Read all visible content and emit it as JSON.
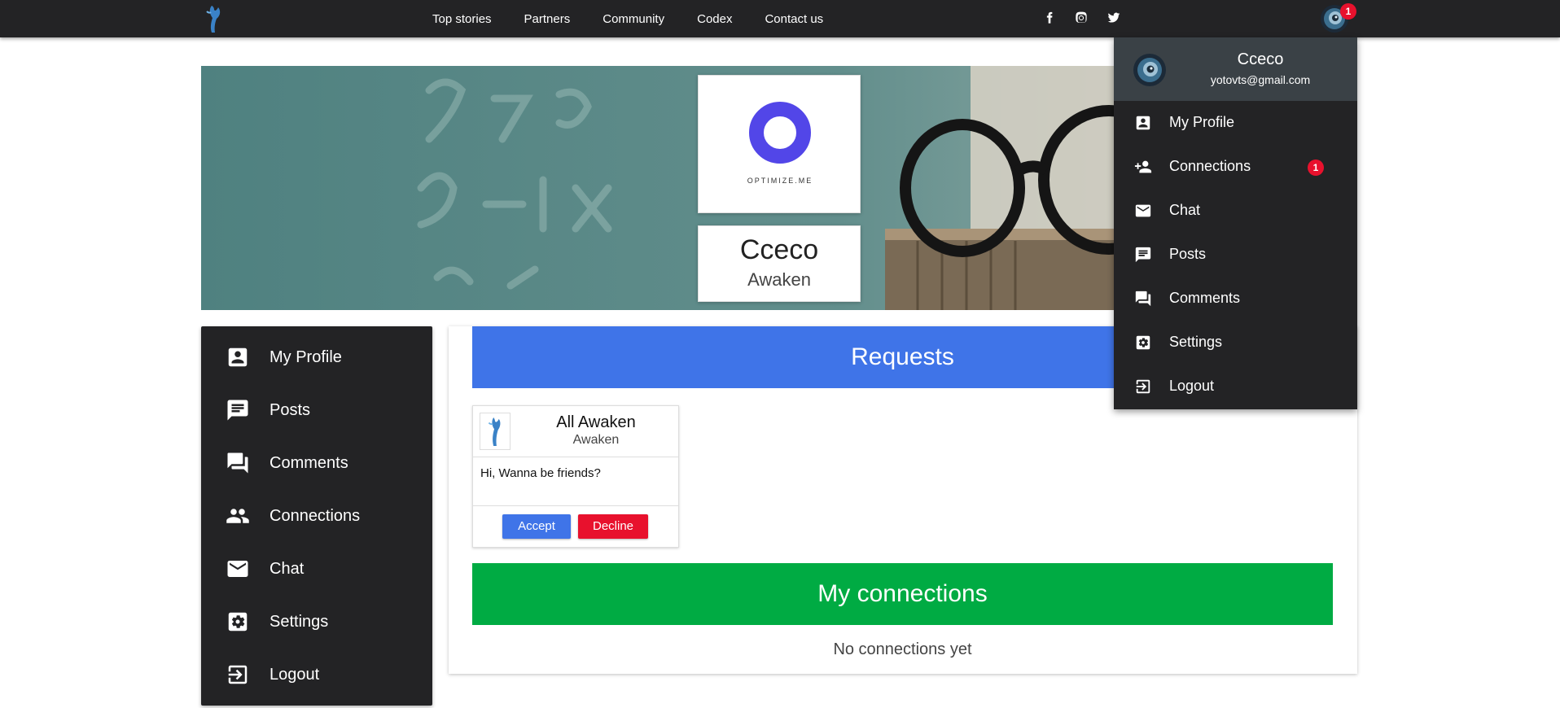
{
  "navbar": {
    "links": [
      "Top stories",
      "Partners",
      "Community",
      "Codex",
      "Contact us"
    ],
    "social_icons": [
      "facebook-icon",
      "instagram-icon",
      "twitter-icon"
    ],
    "notification_count": "1"
  },
  "profile": {
    "name": "Cceco",
    "subtitle": "Awaken",
    "logo_text": "OPTIMIZE.ME",
    "email": "yotovts@gmail.com"
  },
  "sidebar": {
    "items": [
      {
        "label": "My Profile",
        "icon": "account-box-icon"
      },
      {
        "label": "Posts",
        "icon": "post-icon"
      },
      {
        "label": "Comments",
        "icon": "comments-icon"
      },
      {
        "label": "Connections",
        "icon": "people-icon"
      },
      {
        "label": "Chat",
        "icon": "mail-icon"
      },
      {
        "label": "Settings",
        "icon": "settings-icon"
      },
      {
        "label": "Logout",
        "icon": "logout-icon"
      }
    ]
  },
  "requests": {
    "title": "Requests",
    "cards": [
      {
        "name": "All Awaken",
        "subtitle": "Awaken",
        "message": "Hi, Wanna be friends?",
        "accept_label": "Accept",
        "decline_label": "Decline"
      }
    ]
  },
  "connections": {
    "title": "My connections",
    "empty_text": "No connections yet"
  },
  "dropdown": {
    "name": "Cceco",
    "email": "yotovts@gmail.com",
    "items": [
      {
        "label": "My Profile",
        "icon": "account-box-icon"
      },
      {
        "label": "Connections",
        "icon": "person-add-icon",
        "badge": "1"
      },
      {
        "label": "Chat",
        "icon": "mail-icon"
      },
      {
        "label": "Posts",
        "icon": "post-icon"
      },
      {
        "label": "Comments",
        "icon": "comments-icon"
      },
      {
        "label": "Settings",
        "icon": "settings-icon"
      },
      {
        "label": "Logout",
        "icon": "logout-icon"
      }
    ]
  },
  "colors": {
    "dark": "#232325",
    "requests_blue": "#3f74e8",
    "connections_green": "#00ab43",
    "badge_red": "#e8112d",
    "brand_ring": "#5246e8"
  }
}
